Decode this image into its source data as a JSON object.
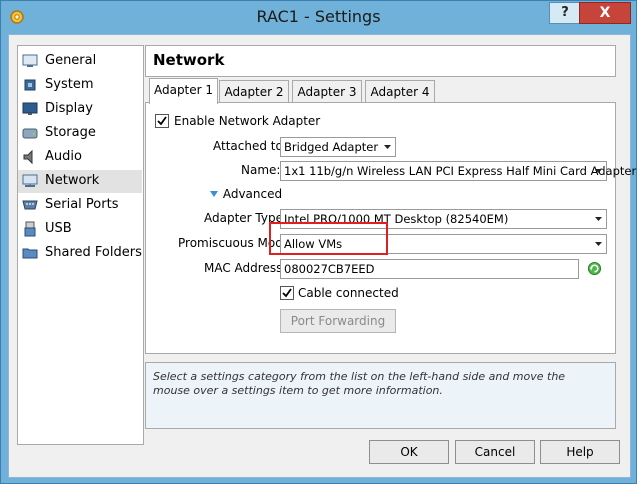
{
  "window": {
    "title": "RAC1 - Settings",
    "help_button": "?",
    "close_button": "X"
  },
  "sidebar": {
    "items": [
      {
        "label": "General",
        "icon": "monitor-general-icon"
      },
      {
        "label": "System",
        "icon": "chip-system-icon"
      },
      {
        "label": "Display",
        "icon": "display-icon"
      },
      {
        "label": "Storage",
        "icon": "storage-disk-icon"
      },
      {
        "label": "Audio",
        "icon": "audio-speaker-icon"
      },
      {
        "label": "Network",
        "icon": "network-icon",
        "selected": true
      },
      {
        "label": "Serial Ports",
        "icon": "serial-port-icon"
      },
      {
        "label": "USB",
        "icon": "usb-icon"
      },
      {
        "label": "Shared Folders",
        "icon": "folder-icon"
      }
    ]
  },
  "page": {
    "title": "Network"
  },
  "tabs": [
    {
      "label": "Adapter 1",
      "active": true
    },
    {
      "label": "Adapter 2"
    },
    {
      "label": "Adapter 3"
    },
    {
      "label": "Adapter 4"
    }
  ],
  "adapter": {
    "enable_label": "Enable Network Adapter",
    "enabled": true,
    "attached_label": "Attached to:",
    "attached_value": "Bridged Adapter",
    "name_label": "Name:",
    "name_value": "1x1 11b/g/n Wireless LAN PCI Express Half Mini Card Adapter",
    "advanced_label": "Advanced",
    "adapter_type_label": "Adapter Type:",
    "adapter_type_value": "Intel PRO/1000 MT Desktop (82540EM)",
    "promiscuous_label": "Promiscuous Mode:",
    "promiscuous_value": "Allow VMs",
    "mac_label": "MAC Address:",
    "mac_value": "080027CB7EED",
    "cable_label": "Cable connected",
    "cable_connected": true,
    "port_forwarding_label": "Port Forwarding"
  },
  "info": {
    "text": "Select a settings category from the list on the left-hand side and move the mouse over a settings item to get more information."
  },
  "buttons": {
    "ok": "OK",
    "cancel": "Cancel",
    "help": "Help"
  },
  "colors": {
    "accent_highlight": "#e02020",
    "close_red": "#c7443a",
    "titlebar": "#6fb1d8"
  }
}
